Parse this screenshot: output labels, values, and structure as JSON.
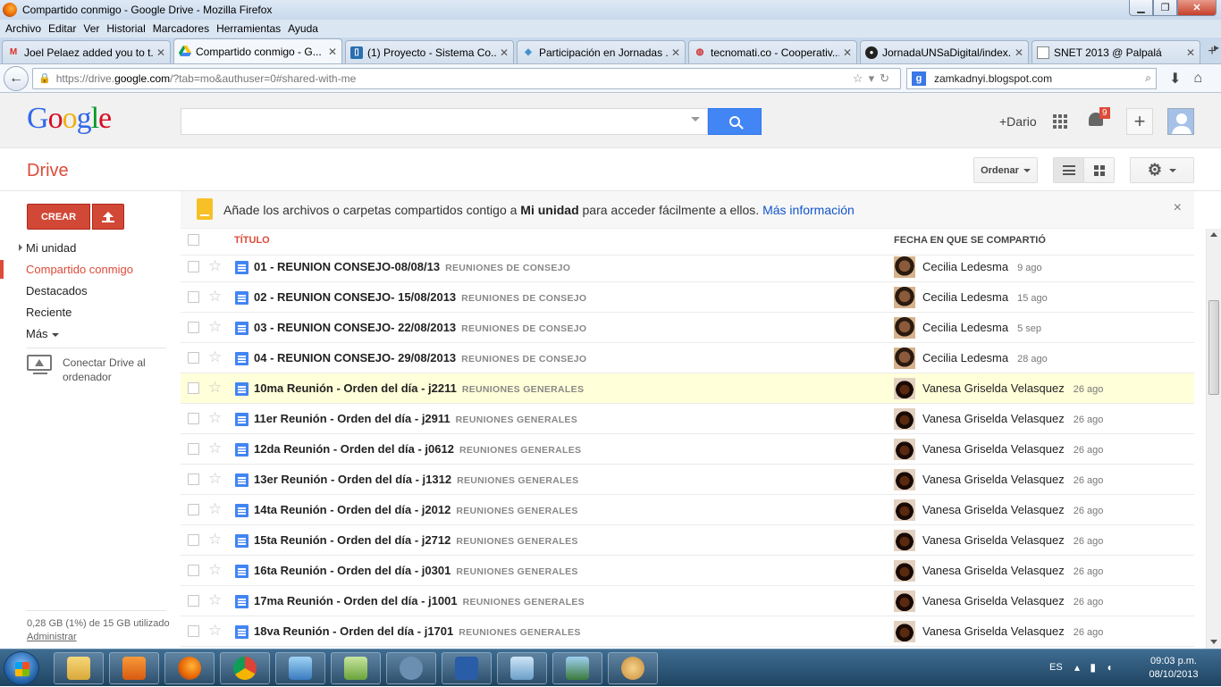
{
  "browser": {
    "window_title": "Compartido conmigo - Google Drive - Mozilla Firefox",
    "menu": [
      "Archivo",
      "Editar",
      "Ver",
      "Historial",
      "Marcadores",
      "Herramientas",
      "Ayuda"
    ],
    "tabs": [
      {
        "label": "Joel Pelaez added you to t...",
        "icon": "gmail-icon"
      },
      {
        "label": "Compartido conmigo - G...",
        "icon": "drive-icon",
        "active": true
      },
      {
        "label": "(1) Proyecto - Sistema Co...",
        "icon": "trello-icon"
      },
      {
        "label": "Participación en Jornadas ...",
        "icon": "globe-icon"
      },
      {
        "label": "tecnomati.co - Cooperativ...",
        "icon": "tecnomati-icon"
      },
      {
        "label": "JornadaUNSaDigital/index....",
        "icon": "github-icon"
      },
      {
        "label": "SNET 2013 @ Palpalá",
        "icon": "page-icon"
      }
    ],
    "url_prefix": "https://drive.",
    "url_host": "google.com",
    "url_rest": "/?tab=mo&authuser=0#shared-with-me",
    "search_value": "zamkadnyi.blogspot.com"
  },
  "google_header": {
    "logo": [
      "G",
      "o",
      "o",
      "g",
      "l",
      "e"
    ],
    "search_value": "",
    "plus_name": "+Dario",
    "notification_count": "9"
  },
  "drive": {
    "title": "Drive",
    "sort_label": "Ordenar",
    "create_label": "CREAR"
  },
  "sidebar": {
    "items": [
      {
        "label": "Mi unidad"
      },
      {
        "label": "Compartido conmigo",
        "active": true
      },
      {
        "label": "Destacados"
      },
      {
        "label": "Reciente"
      },
      {
        "label": "Más"
      }
    ],
    "connect_label": "Conectar Drive al ordenador",
    "quota": "0,28 GB (1%) de 15 GB utilizado",
    "admin_label": "Administrar"
  },
  "notice": {
    "text_before": "Añade los archivos o carpetas compartidos contigo a ",
    "bold": "Mi unidad",
    "text_after": " para acceder fácilmente a ellos. ",
    "link": "Más información",
    "close": "×"
  },
  "table": {
    "col_title": "TÍTULO",
    "col_date": "FECHA EN QUE SE COMPARTIÓ",
    "rows": [
      {
        "name": "01 - REUNION CONSEJO-08/08/13",
        "folder": "REUNIONES DE CONSEJO",
        "owner": "Cecilia Ledesma",
        "date": "9 ago",
        "avatar": "cl",
        "highlight": false
      },
      {
        "name": "02 - REUNION CONSEJO- 15/08/2013",
        "folder": "REUNIONES DE CONSEJO",
        "owner": "Cecilia Ledesma",
        "date": "15 ago",
        "avatar": "cl",
        "highlight": false
      },
      {
        "name": "03 - REUNION CONSEJO- 22/08/2013",
        "folder": "REUNIONES DE CONSEJO",
        "owner": "Cecilia Ledesma",
        "date": "5 sep",
        "avatar": "cl",
        "highlight": false
      },
      {
        "name": "04 - REUNION CONSEJO- 29/08/2013",
        "folder": "REUNIONES DE CONSEJO",
        "owner": "Cecilia Ledesma",
        "date": "28 ago",
        "avatar": "cl",
        "highlight": false
      },
      {
        "name": "10ma Reunión - Orden del día - j2211",
        "folder": "REUNIONES GENERALES",
        "owner": "Vanesa Griselda Velasquez",
        "date": "26 ago",
        "avatar": "vg",
        "highlight": true
      },
      {
        "name": "11er Reunión - Orden del día - j2911",
        "folder": "REUNIONES GENERALES",
        "owner": "Vanesa Griselda Velasquez",
        "date": "26 ago",
        "avatar": "vg",
        "highlight": false
      },
      {
        "name": "12da Reunión - Orden del día - j0612",
        "folder": "REUNIONES GENERALES",
        "owner": "Vanesa Griselda Velasquez",
        "date": "26 ago",
        "avatar": "vg",
        "highlight": false
      },
      {
        "name": "13er Reunión - Orden del día - j1312",
        "folder": "REUNIONES GENERALES",
        "owner": "Vanesa Griselda Velasquez",
        "date": "26 ago",
        "avatar": "vg",
        "highlight": false
      },
      {
        "name": "14ta Reunión - Orden del día - j2012",
        "folder": "REUNIONES GENERALES",
        "owner": "Vanesa Griselda Velasquez",
        "date": "26 ago",
        "avatar": "vg",
        "highlight": false
      },
      {
        "name": "15ta Reunión - Orden del día - j2712",
        "folder": "REUNIONES GENERALES",
        "owner": "Vanesa Griselda Velasquez",
        "date": "26 ago",
        "avatar": "vg",
        "highlight": false
      },
      {
        "name": "16ta Reunión - Orden del día - j0301",
        "folder": "REUNIONES GENERALES",
        "owner": "Vanesa Griselda Velasquez",
        "date": "26 ago",
        "avatar": "vg",
        "highlight": false
      },
      {
        "name": "17ma Reunión - Orden del día - j1001",
        "folder": "REUNIONES GENERALES",
        "owner": "Vanesa Griselda Velasquez",
        "date": "26 ago",
        "avatar": "vg",
        "highlight": false
      },
      {
        "name": "18va Reunión - Orden del día - j1701",
        "folder": "REUNIONES GENERALES",
        "owner": "Vanesa Griselda Velasquez",
        "date": "26 ago",
        "avatar": "vg",
        "highlight": false
      }
    ]
  },
  "taskbar": {
    "apps": [
      "explorer-icon",
      "media-player-icon",
      "firefox-icon",
      "chrome-icon",
      "virtualbox-icon",
      "notepad-icon",
      "app-icon",
      "powershell-icon",
      "control-panel-icon",
      "photos-icon",
      "paint-icon"
    ],
    "lang": "ES",
    "time": "09:03 p.m.",
    "date": "08/10/2013"
  },
  "colors": {
    "drive_red": "#dd4b39",
    "create_button": "#d14836",
    "search_blue": "#4285f4",
    "highlight_row": "#ffffd9",
    "link_blue": "#1155cc"
  }
}
